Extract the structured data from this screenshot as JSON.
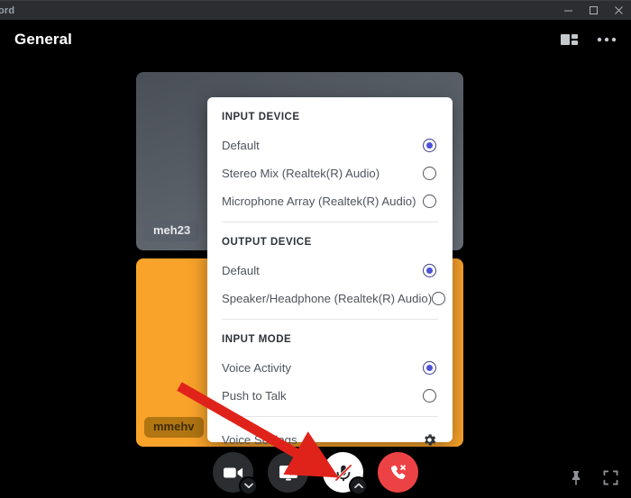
{
  "window": {
    "app_title": "ord",
    "controls": [
      {
        "name": "minimize",
        "glyph": "minimize-icon"
      },
      {
        "name": "maximize",
        "glyph": "maximize-icon"
      },
      {
        "name": "close",
        "glyph": "close-icon"
      }
    ]
  },
  "header": {
    "title": "General",
    "actions": [
      {
        "name": "layout-view-icon",
        "label": "Change layout"
      },
      {
        "name": "more-options-icon",
        "label": "More options"
      }
    ]
  },
  "call": {
    "participants": [
      {
        "name": "meh23",
        "tile": "top"
      },
      {
        "name": "mmehv",
        "tile": "bottom"
      }
    ]
  },
  "popup": {
    "sections": [
      {
        "title": "INPUT DEVICE",
        "options": [
          {
            "label": "Default",
            "selected": true
          },
          {
            "label": "Stereo Mix (Realtek(R) Audio)",
            "selected": false
          },
          {
            "label": "Microphone Array (Realtek(R) Audio)",
            "selected": false
          }
        ]
      },
      {
        "title": "OUTPUT DEVICE",
        "options": [
          {
            "label": "Default",
            "selected": true
          },
          {
            "label": "Speaker/Headphone (Realtek(R) Audio)",
            "selected": false
          }
        ]
      },
      {
        "title": "INPUT MODE",
        "options": [
          {
            "label": "Voice Activity",
            "selected": true
          },
          {
            "label": "Push to Talk",
            "selected": false
          }
        ]
      }
    ],
    "voice_settings_label": "Voice Settings"
  },
  "controls": {
    "buttons": [
      {
        "name": "camera-button",
        "icon": "camera-icon",
        "badge": "chevron-down-icon",
        "state": "off"
      },
      {
        "name": "screen-share-button",
        "icon": "screen-share-icon",
        "badge": null,
        "state": "off"
      },
      {
        "name": "microphone-button",
        "icon": "microphone-muted-icon",
        "badge": "chevron-up-icon",
        "state": "muted"
      },
      {
        "name": "end-call-button",
        "icon": "phone-hangup-icon",
        "badge": null,
        "state": "active"
      }
    ],
    "corner": [
      {
        "name": "pin-button",
        "icon": "pin-icon"
      },
      {
        "name": "fullscreen-button",
        "icon": "fullscreen-icon"
      }
    ]
  },
  "colors": {
    "accent_blue": "#4a52d8",
    "danger_red": "#ed4245",
    "tile_orange": "#f9a32a",
    "annotation_red": "#e0231a",
    "popup_bg": "#ffffff",
    "app_bg": "#000000",
    "titlebar_bg": "#2b2d31"
  }
}
